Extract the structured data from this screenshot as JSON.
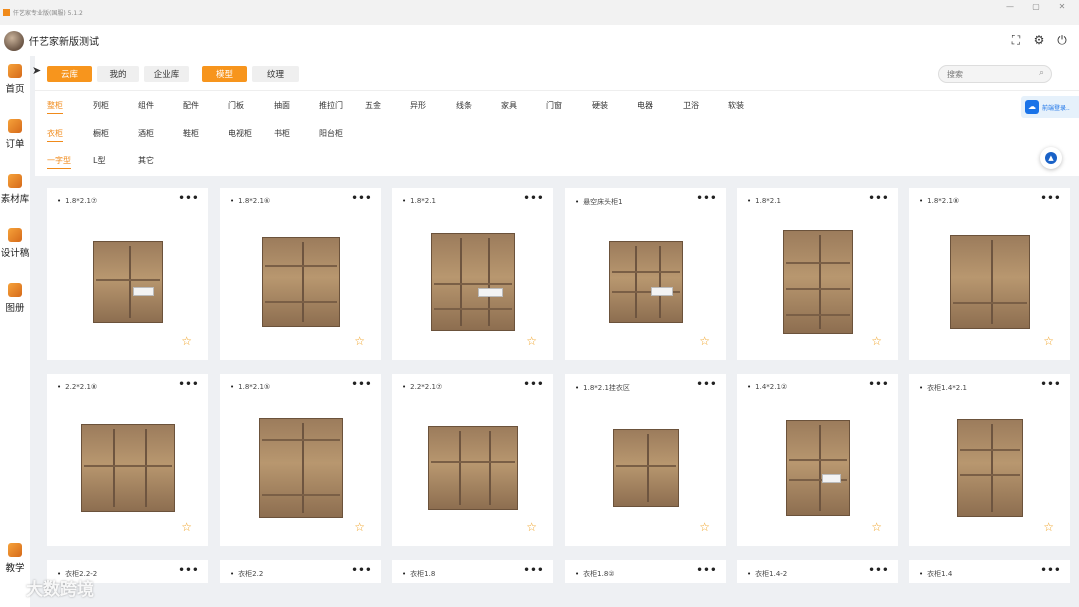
{
  "window": {
    "title": "仟艺家专业版(国服) 5.1.2",
    "controls": [
      "—",
      "▢",
      "✕"
    ]
  },
  "header": {
    "user_name": "仟艺家新版测试"
  },
  "sidebar": {
    "items": [
      {
        "label": "首页",
        "icon": "home-icon"
      },
      {
        "label": "订单",
        "icon": "order-icon"
      },
      {
        "label": "素材库",
        "icon": "material-icon"
      },
      {
        "label": "设计稿",
        "icon": "design-icon"
      },
      {
        "label": "图册",
        "icon": "album-icon"
      },
      {
        "label": "教学",
        "icon": "teach-icon"
      }
    ]
  },
  "source_tabs": [
    {
      "label": "云库",
      "active": true
    },
    {
      "label": "我的",
      "active": false
    },
    {
      "label": "企业库",
      "active": false
    }
  ],
  "type_tabs": [
    {
      "label": "模型",
      "active": true
    },
    {
      "label": "纹理",
      "active": false
    }
  ],
  "search": {
    "placeholder": "搜索"
  },
  "categories": {
    "level1": [
      "整柜",
      "列柜",
      "组件",
      "配件",
      "门板",
      "抽面",
      "推拉门",
      "五金",
      "异形",
      "线条",
      "家具",
      "门窗",
      "硬装",
      "电器",
      "卫浴",
      "软装"
    ],
    "level2": [
      "衣柜",
      "橱柜",
      "酒柜",
      "鞋柜",
      "电视柜",
      "书柜",
      "阳台柜"
    ],
    "level3": [
      "一字型",
      "L型",
      "其它"
    ]
  },
  "float_tip": "前端登录..",
  "cards": [
    {
      "name": "1.8*2.1⑦"
    },
    {
      "name": "1.8*2.1⑥"
    },
    {
      "name": "1.8*2.1"
    },
    {
      "name": "悬空床头柜1"
    },
    {
      "name": "1.8*2.1"
    },
    {
      "name": "1.8*2.1⑧"
    },
    {
      "name": "2.2*2.1⑧"
    },
    {
      "name": "1.8*2.1⑤"
    },
    {
      "name": "2.2*2.1⑦"
    },
    {
      "name": "1.8*2.1挂衣区"
    },
    {
      "name": "1.4*2.1②"
    },
    {
      "name": "衣柜1.4*2.1"
    },
    {
      "name": "衣柜2.2-2"
    },
    {
      "name": "衣柜2.2"
    },
    {
      "name": "衣柜1.8"
    },
    {
      "name": "衣柜1.8②"
    },
    {
      "name": "衣柜1.4-2"
    },
    {
      "name": "衣柜1.4"
    }
  ],
  "more_label": "•••",
  "star_label": "☆",
  "watermark": "大数跨境",
  "colors": {
    "accent": "#f7951d",
    "link_blue": "#1a73e8"
  }
}
